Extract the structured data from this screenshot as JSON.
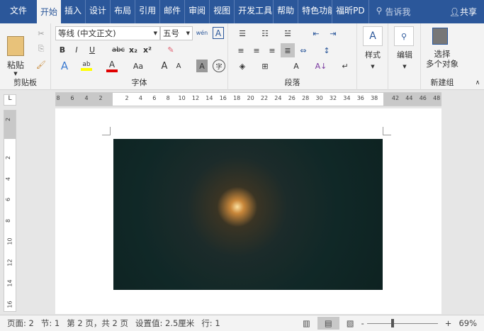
{
  "tabs": {
    "file": "文件",
    "items": [
      "开始",
      "插入",
      "设计",
      "布局",
      "引用",
      "邮件",
      "审阅",
      "视图",
      "开发工具",
      "帮助",
      "特色功能",
      "福昕PD"
    ],
    "search": "告诉我",
    "share": "共享"
  },
  "clipboard": {
    "paste": "粘贴",
    "label": "剪贴板"
  },
  "font": {
    "name": "等线 (中文正文)",
    "size": "五号",
    "label": "字体",
    "bold": "B",
    "italic": "I",
    "underline": "U",
    "strike": "abc",
    "sub": "x₂",
    "sup": "x²",
    "phonetic": "wén",
    "textA": "A",
    "case": "Aa",
    "grow": "A",
    "shrink": "A",
    "shade": "A",
    "enclose": "字",
    "highlight_color": "#ffff00",
    "font_color": "#e00000"
  },
  "paragraph": {
    "label": "段落"
  },
  "styles": {
    "label": "样式"
  },
  "editing": {
    "label": "编辑"
  },
  "newgroup": {
    "select": "选择",
    "multi": "多个对象",
    "label": "新建组"
  },
  "ruler": {
    "h_left": [
      "8",
      "6",
      "4",
      "2"
    ],
    "h_main": [
      "2",
      "4",
      "6",
      "8",
      "10",
      "12",
      "14",
      "16",
      "18",
      "20",
      "22",
      "24",
      "26",
      "28",
      "30",
      "32",
      "34",
      "36",
      "38"
    ],
    "h_right": [
      "42",
      "44",
      "46",
      "48"
    ],
    "v": [
      "2",
      "2",
      "4",
      "6",
      "8",
      "10",
      "12",
      "14",
      "16"
    ],
    "corner": "L"
  },
  "status": {
    "page": "页面: 2",
    "section": "节: 1",
    "pages": "第 2 页，共 2 页",
    "setting": "设置值: 2.5厘米",
    "line": "行: 1",
    "zoom": "69%"
  }
}
